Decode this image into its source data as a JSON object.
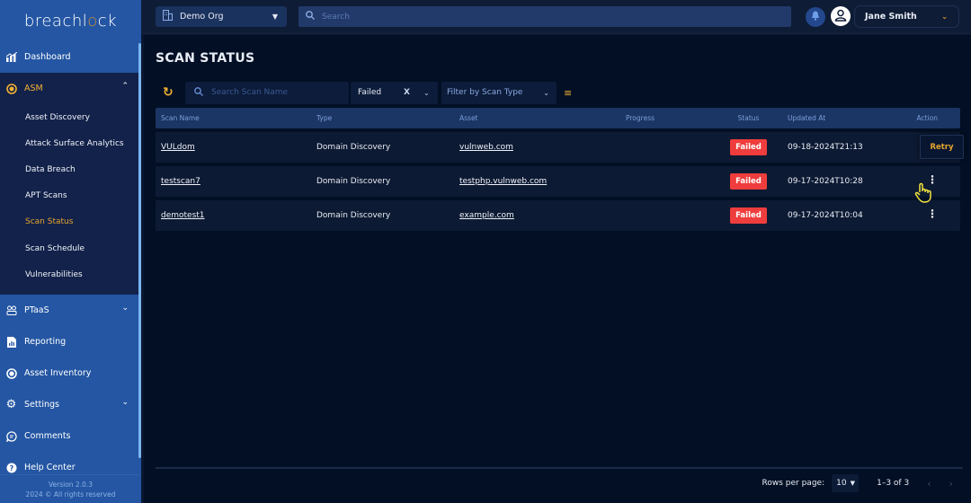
{
  "brand": {
    "prefix": "breachl",
    "o": "o",
    "suffix": "ck"
  },
  "sidebar": {
    "items": [
      {
        "label": "Dashboard",
        "icon": "chart-icon"
      },
      {
        "label": "ASM",
        "icon": "target-icon",
        "expanded": true
      },
      {
        "label": "PTaaS",
        "icon": "users-icon"
      },
      {
        "label": "Reporting",
        "icon": "report-icon"
      },
      {
        "label": "Asset Inventory",
        "icon": "asset-icon"
      },
      {
        "label": "Settings",
        "icon": "gear-icon"
      },
      {
        "label": "Comments",
        "icon": "comment-icon"
      },
      {
        "label": "Help Center",
        "icon": "help-icon"
      }
    ],
    "asm_sub": [
      "Asset Discovery",
      "Attack Surface Analytics",
      "Data Breach",
      "APT Scans",
      "Scan Status",
      "Scan Schedule",
      "Vulnerabilities"
    ],
    "active_sub": "Scan Status",
    "version": "Version 2.0.3",
    "copyright": "2024 © All rights reserved"
  },
  "topbar": {
    "org": "Demo Org",
    "search_placeholder": "Search",
    "user_name": "Jane Smith"
  },
  "page": {
    "title": "SCAN STATUS",
    "filters": {
      "search_placeholder": "Search Scan Name",
      "status_value": "Failed",
      "clear": "X",
      "type_placeholder": "Filter by Scan Type"
    },
    "table": {
      "headers": [
        "Scan Name",
        "Type",
        "Asset",
        "Progress",
        "Status",
        "Updated At",
        "Action"
      ],
      "rows": [
        {
          "name": "VULdom",
          "type": "Domain Discovery",
          "asset": "vulnweb.com",
          "progress": "",
          "status": "Failed",
          "updated": "09-18-2024T21:13"
        },
        {
          "name": "testscan7",
          "type": "Domain Discovery",
          "asset": "testphp.vulnweb.com",
          "progress": "",
          "status": "Failed",
          "updated": "09-17-2024T10:28"
        },
        {
          "name": "demotest1",
          "type": "Domain Discovery",
          "asset": "example.com",
          "progress": "",
          "status": "Failed",
          "updated": "09-17-2024T10:04"
        }
      ],
      "retry_label": "Retry"
    },
    "pagination": {
      "rows_per_page_label": "Rows per page:",
      "rows_per_page": "10",
      "range": "1–3 of 3",
      "prev": "‹",
      "next": "›"
    }
  },
  "colors": {
    "accent": "#e5a52e",
    "sidebar": "#2456a3",
    "failed": "#ef3d3d"
  }
}
